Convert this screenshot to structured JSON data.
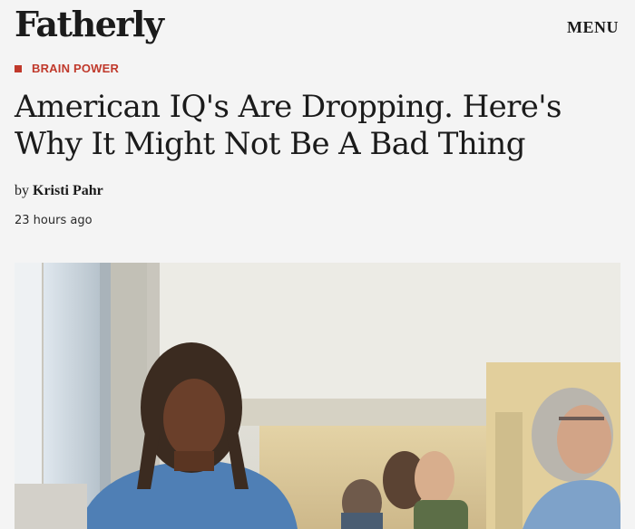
{
  "header": {
    "logo": "Fatherly",
    "menu_label": "MENU"
  },
  "category": {
    "label": "BRAIN POWER",
    "accent_color": "#c0392b"
  },
  "article": {
    "headline": "American IQ's Are Dropping. Here's Why It Might Not Be A Bad Thing",
    "byline_prefix": "by",
    "author": "Kristi Pahr",
    "timestamp": "23 hours ago"
  },
  "hero_image": {
    "icon": "photo-audience-seated"
  }
}
